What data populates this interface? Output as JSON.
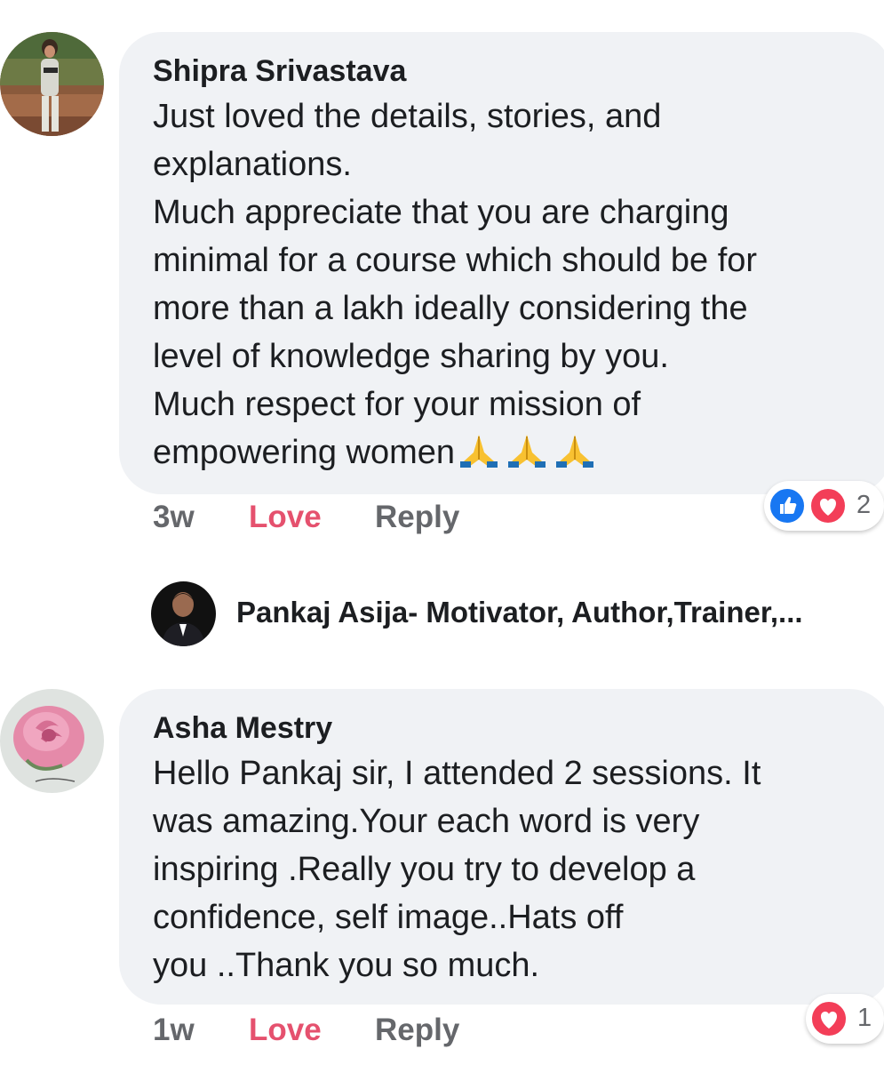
{
  "comments": [
    {
      "author": "Shipra Srivastava",
      "avatar": "profile-photo-woman",
      "lines": [
        "Just loved the details, stories, and",
        "explanations.",
        "Much appreciate that you are charging",
        "minimal for a course which should be for",
        "more than a lakh ideally considering the",
        "level of knowledge sharing by you.",
        "Much respect for your mission of",
        "empowering women"
      ],
      "emoji": [
        "folded-hands",
        "folded-hands",
        "folded-hands"
      ],
      "time": "3w",
      "love_label": "Love",
      "reply_label": "Reply",
      "reactions": {
        "icons": [
          "like-icon",
          "love-icon"
        ],
        "count": "2"
      }
    },
    {
      "author": "Asha Mestry",
      "avatar": "pink-rose-photo",
      "lines": [
        "Hello Pankaj sir, I attended 2 sessions. It",
        "was amazing.Your each word is  very",
        "inspiring .Really  you try to develop a",
        "confidence,  self image..Hats off",
        "you ..Thank you so much."
      ],
      "time": "1w",
      "love_label": "Love",
      "reply_label": "Reply",
      "reactions": {
        "icons": [
          "love-icon"
        ],
        "count": "1"
      }
    }
  ],
  "reply_preview": {
    "author": "Pankaj Asija- Motivator, Author,Trainer,...",
    "avatar": "profile-photo-man"
  },
  "colors": {
    "bubble": "#f0f2f5",
    "love": "#e5516e",
    "meta": "#65676b",
    "like_blue": "#1877f2",
    "love_red": "#f33e58"
  }
}
